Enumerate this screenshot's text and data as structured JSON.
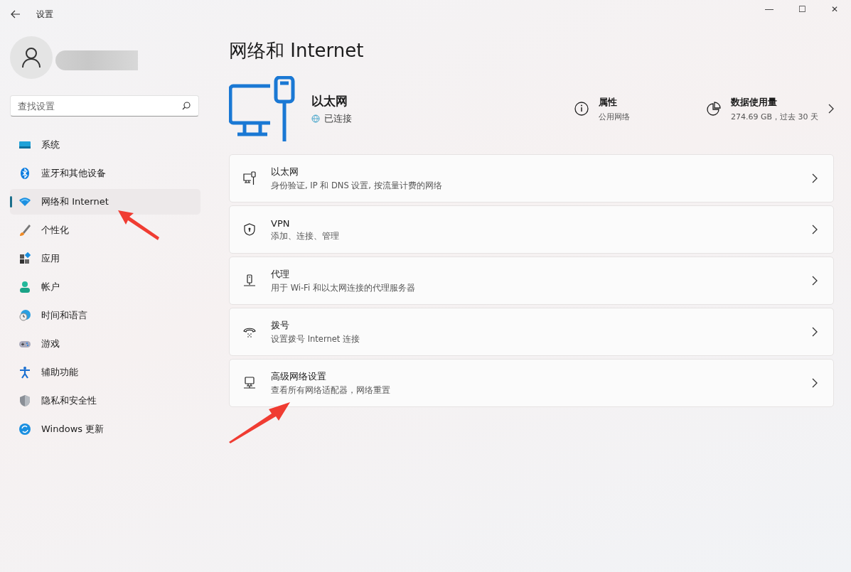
{
  "window": {
    "title": "设置",
    "controls": [
      "—",
      "☐",
      "✕"
    ]
  },
  "search": {
    "placeholder": "查找设置"
  },
  "sidebar": {
    "items": [
      {
        "label": "系统",
        "selected": false
      },
      {
        "label": "蓝牙和其他设备",
        "selected": false
      },
      {
        "label": "网络和 Internet",
        "selected": true
      },
      {
        "label": "个性化",
        "selected": false
      },
      {
        "label": "应用",
        "selected": false
      },
      {
        "label": "帐户",
        "selected": false
      },
      {
        "label": "时间和语言",
        "selected": false
      },
      {
        "label": "游戏",
        "selected": false
      },
      {
        "label": "辅助功能",
        "selected": false
      },
      {
        "label": "隐私和安全性",
        "selected": false
      },
      {
        "label": "Windows 更新",
        "selected": false
      }
    ]
  },
  "page": {
    "title": "网络和 Internet"
  },
  "header": {
    "name": "以太网",
    "status": "已连接",
    "properties": {
      "title": "属性",
      "value": "公用网络"
    },
    "usage": {
      "title": "数据使用量",
      "value": "274.69 GB，过去 30 天"
    }
  },
  "cards": [
    {
      "title": "以太网",
      "subtitle": "身份验证, IP 和 DNS 设置, 按流量计费的网络"
    },
    {
      "title": "VPN",
      "subtitle": "添加、连接、管理"
    },
    {
      "title": "代理",
      "subtitle": "用于 Wi-Fi 和以太网连接的代理服务器"
    },
    {
      "title": "拨号",
      "subtitle": "设置拨号 Internet 连接"
    },
    {
      "title": "高级网络设置",
      "subtitle": "查看所有网络适配器，网络重置"
    }
  ]
}
